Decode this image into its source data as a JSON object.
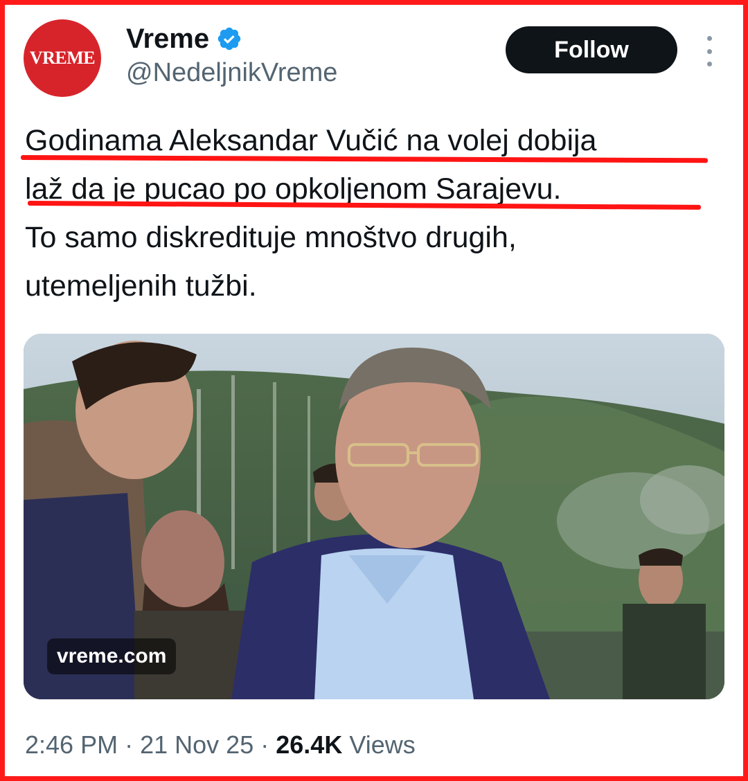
{
  "account": {
    "avatar_text": "VREME",
    "display_name": "Vreme",
    "handle": "@NedeljnikVreme",
    "verified": true
  },
  "actions": {
    "follow_label": "Follow",
    "more_icon": "more-vertical-icon"
  },
  "tweet": {
    "lines": [
      "Godinama Aleksandar Vučić na volej dobija",
      "laž da je pucao po opkoljenom Sarajevu.",
      "To samo diskredituje mnoštvo drugih,",
      "utemeljenih tužbi."
    ]
  },
  "media": {
    "watermark": "vreme.com"
  },
  "meta": {
    "time": "2:46 PM",
    "separator": "·",
    "date": "21 Nov 25",
    "views_count": "26.4K",
    "views_label": "Views"
  },
  "colors": {
    "highlight_red": "#ff1414",
    "avatar_red": "#d7242b",
    "verified_blue": "#1d9bf0",
    "follow_bg": "#0f1419",
    "secondary_text": "#536471"
  }
}
